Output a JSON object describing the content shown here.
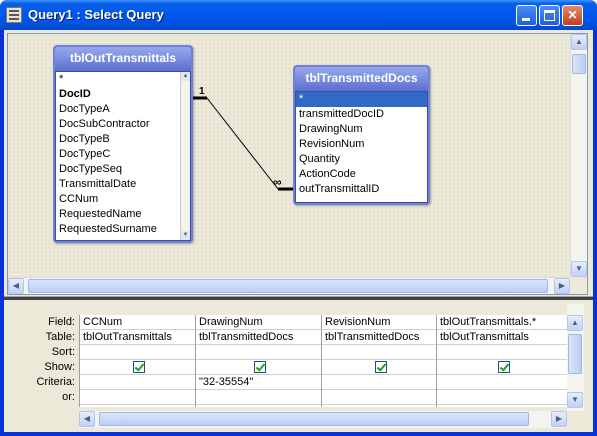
{
  "window": {
    "title": "Query1 : Select Query",
    "titlebar_color": "#0054e3",
    "controls": {
      "minimize": "minimize-icon",
      "maximize": "maximize-icon",
      "close": "close-icon"
    }
  },
  "tables": [
    {
      "name": "tblOutTransmittals",
      "fields": [
        "*",
        "DocID",
        "DocTypeA",
        "DocSubContractor",
        "DocTypeB",
        "DocTypeC",
        "DocTypeSeq",
        "TransmittalDate",
        "CCNum",
        "RequestedName",
        "RequestedSurname"
      ],
      "bold_field": "DocID"
    },
    {
      "name": "tblTransmittedDocs",
      "fields": [
        "*",
        "transmittedDocID",
        "DrawingNum",
        "RevisionNum",
        "Quantity",
        "ActionCode",
        "outTransmittalID"
      ],
      "selected_field": "*"
    }
  ],
  "relationship": {
    "one_side": "1",
    "many_side": "∞"
  },
  "grid": {
    "row_labels": [
      "Field:",
      "Table:",
      "Sort:",
      "Show:",
      "Criteria:",
      "or:"
    ],
    "columns": [
      {
        "field": "CCNum",
        "table": "tblOutTransmittals",
        "sort": "",
        "show": true,
        "criteria": "",
        "or": ""
      },
      {
        "field": "DrawingNum",
        "table": "tblTransmittedDocs",
        "sort": "",
        "show": true,
        "criteria": "\"32-35554\"",
        "or": ""
      },
      {
        "field": "RevisionNum",
        "table": "tblTransmittedDocs",
        "sort": "",
        "show": true,
        "criteria": "",
        "or": ""
      },
      {
        "field": "tblOutTransmittals.*",
        "table": "tblOutTransmittals",
        "sort": "",
        "show": true,
        "criteria": "",
        "or": ""
      }
    ]
  }
}
